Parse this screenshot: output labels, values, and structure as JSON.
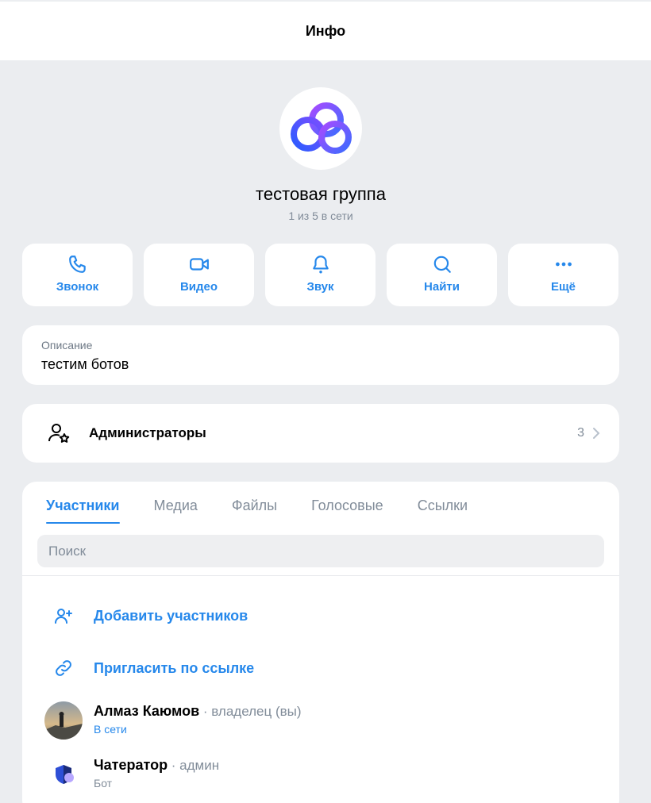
{
  "header": {
    "title": "Инфо"
  },
  "group": {
    "name": "тестовая группа",
    "status": "1 из 5 в сети"
  },
  "actions": [
    {
      "label": "Звонок",
      "icon": "phone-icon"
    },
    {
      "label": "Видео",
      "icon": "video-icon"
    },
    {
      "label": "Звук",
      "icon": "bell-icon"
    },
    {
      "label": "Найти",
      "icon": "search-icon"
    },
    {
      "label": "Ещё",
      "icon": "more-icon"
    }
  ],
  "description": {
    "label": "Описание",
    "text": "тестим ботов"
  },
  "admins": {
    "label": "Администраторы",
    "count": "3"
  },
  "tabs": [
    {
      "label": "Участники",
      "active": true
    },
    {
      "label": "Медиа",
      "active": false
    },
    {
      "label": "Файлы",
      "active": false
    },
    {
      "label": "Голосовые",
      "active": false
    },
    {
      "label": "Ссылки",
      "active": false
    }
  ],
  "search": {
    "placeholder": "Поиск",
    "value": ""
  },
  "member_actions": {
    "add": "Добавить участников",
    "invite": "Пригласить по ссылке"
  },
  "members": [
    {
      "name": "Алмаз Каюмов",
      "role": " · владелец (вы)",
      "sub": "В сети"
    },
    {
      "name": "Чатератор",
      "role": " · админ",
      "sub": "Бот"
    }
  ],
  "colors": {
    "accent": "#2688eb",
    "secondary": "#818c99",
    "background": "#ebedf0"
  }
}
